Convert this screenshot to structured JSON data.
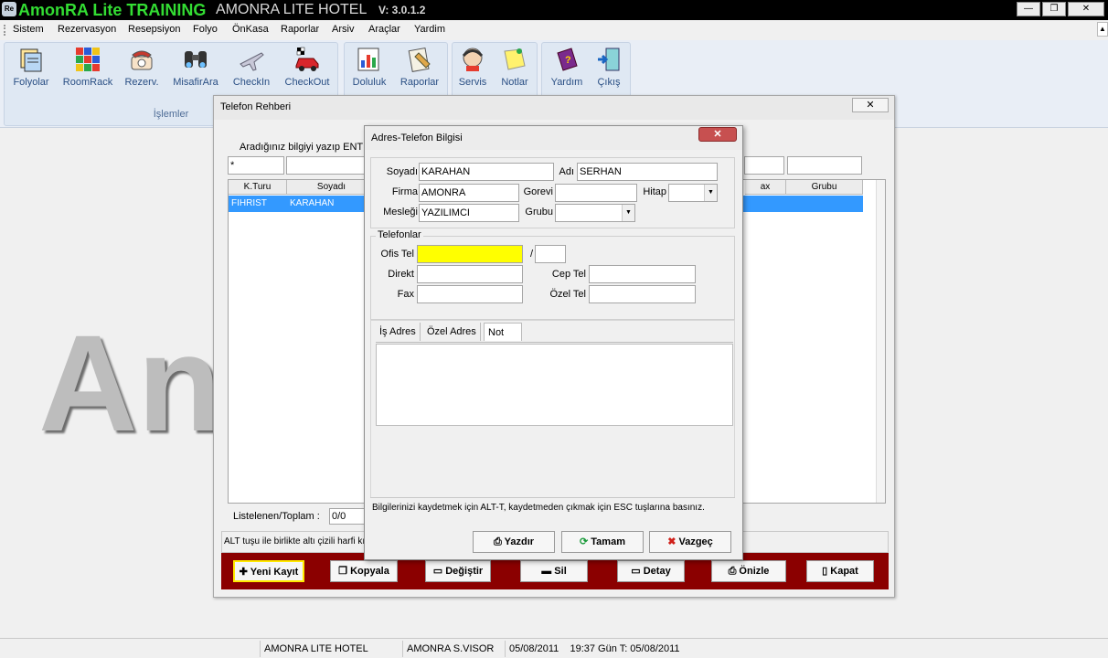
{
  "app": {
    "icon_text": "Re",
    "title": "AmonRA Lite TRAINING",
    "hotel_name": "AMONRA LITE HOTEL",
    "version": "V: 3.0.1.2",
    "window_buttons": {
      "minimize": "—",
      "restore": "❐",
      "close": "✕"
    }
  },
  "menu": [
    "Sistem",
    "Rezervasyon",
    "Resepsiyon",
    "Folyo",
    "ÖnKasa",
    "Raporlar",
    "Arsiv",
    "Araçlar",
    "Yardim"
  ],
  "toolbar": {
    "group1_label": "İşlemler",
    "buttons": [
      {
        "label": "Folyolar",
        "icon": "folders-icon"
      },
      {
        "label": "RoomRack",
        "icon": "room-rack-icon"
      },
      {
        "label": "Rezerv.",
        "icon": "reservation-phone-icon"
      },
      {
        "label": "MisafirAra",
        "icon": "binoculars-icon"
      },
      {
        "label": "CheckIn",
        "icon": "plane-icon"
      },
      {
        "label": "CheckOut",
        "icon": "car-icon"
      },
      {
        "label": "Doluluk",
        "icon": "occupancy-chart-icon"
      },
      {
        "label": "Raporlar",
        "icon": "reports-icon"
      },
      {
        "label": "Servis",
        "icon": "service-icon"
      },
      {
        "label": "Notlar",
        "icon": "notes-icon"
      },
      {
        "label": "Yardım",
        "icon": "help-book-icon"
      },
      {
        "label": "Çıkış",
        "icon": "exit-door-icon"
      }
    ]
  },
  "background_logo_text": "An",
  "status_bar": {
    "hotel": "AMONRA LITE HOTEL",
    "user": "AMONRA S.VISOR",
    "date_time": "05/08/2011    19:37 Gün T: 05/08/2011"
  },
  "rehberi": {
    "title": "Telefon Rehberi",
    "close": "✕",
    "search_label": "Aradığınız bilgiyi yazıp ENT",
    "search_value": "*",
    "columns": {
      "k_turu": "K.Turu",
      "soyadi": "Soyadı",
      "fax": "ax",
      "grubu": "Grubu"
    },
    "rows": [
      {
        "k_turu": "FIHRIST",
        "soyadi": "KARAHAN"
      }
    ],
    "listed_label": "Listelenen/Toplam :",
    "listed_value": "0/0",
    "hint": "ALT tuşu ile birlikte altı çizili harfi kı",
    "buttons": {
      "yeni_kayit": "Yeni Kayıt",
      "kopyala": "Kopyala",
      "degistir": "Değiştir",
      "sil": "Sil",
      "detay": "Detay",
      "onizle": "Önizle",
      "kapat": "Kapat"
    }
  },
  "dialog": {
    "title": "Adres-Telefon Bilgisi",
    "close": "✕",
    "labels": {
      "soyadi": "Soyadı",
      "adi": "Adı",
      "firma": "Firma",
      "gorevi": "Gorevi",
      "hitap": "Hitap",
      "meslegi": "Mesleği",
      "grubu": "Grubu",
      "telefonlar": "Telefonlar",
      "ofis_tel": "Ofis Tel",
      "slash": "/",
      "direkt": "Direkt",
      "fax": "Fax",
      "cep_tel": "Cep Tel",
      "ozel_tel": "Özel Tel"
    },
    "values": {
      "soyadi": "KARAHAN",
      "adi": "SERHAN",
      "firma": "AMONRA",
      "gorevi": "",
      "hitap": "",
      "meslegi": "YAZILIMCI",
      "grubu": "",
      "ofis_tel": "",
      "ofis_ext": "",
      "direkt": "",
      "fax": "",
      "cep_tel": "",
      "ozel_tel": ""
    },
    "tabs": [
      "İş Adres",
      "Özel Adres",
      "Not"
    ],
    "active_tab": "Not",
    "hint": "Bilgilerinizi kaydetmek için ALT-T, kaydetmeden çıkmak için ESC tuşlarına basınız.",
    "buttons": {
      "yazdir": "Yazdır",
      "tamam": "Tamam",
      "vazgec": "Vazgeç"
    },
    "highlight_color": "#ffff00"
  }
}
